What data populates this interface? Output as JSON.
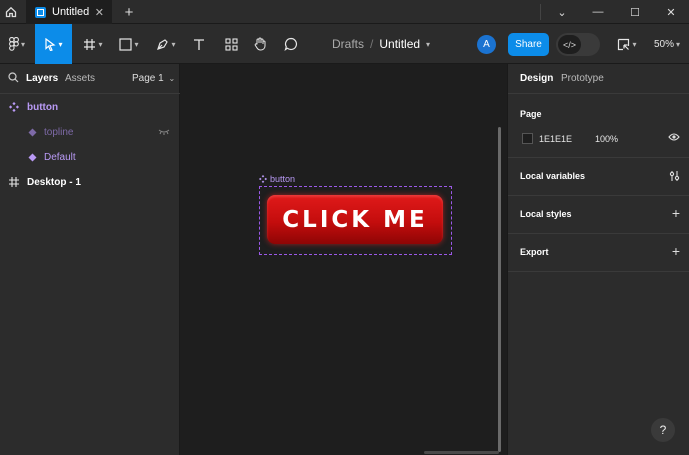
{
  "titlebar": {
    "tab_label": "Untitled",
    "new_tab_symbol": "+",
    "close_symbol": "✕",
    "win_chevron": "⌄",
    "win_minimize": "—",
    "win_maximize": "☐",
    "win_close": "✕"
  },
  "toolbar": {
    "crumb_drafts": "Drafts",
    "crumb_sep": "/",
    "crumb_file": "Untitled",
    "avatar_initial": "A",
    "share_label": "Share",
    "dev_mode_symbol": "</>",
    "zoom_value": "50%",
    "tools": [
      "figma-menu",
      "move",
      "frame",
      "shape",
      "pen",
      "text",
      "components",
      "hand",
      "comment"
    ]
  },
  "left_panel": {
    "tab_layers": "Layers",
    "tab_assets": "Assets",
    "page_selector": "Page 1",
    "layers": [
      {
        "name": "button",
        "kind": "component-set",
        "color": "#b99af5"
      },
      {
        "name": "topline",
        "kind": "variant-hidden",
        "color": "#7e6aa8"
      },
      {
        "name": "Default",
        "kind": "variant",
        "color": "#b99af5"
      },
      {
        "name": "Desktop - 1",
        "kind": "frame",
        "color": "#ffffff"
      }
    ]
  },
  "canvas": {
    "frame_label": "button",
    "button_text": "CLICK ME",
    "button_color": "#d41111"
  },
  "right_panel": {
    "tab_design": "Design",
    "tab_prototype": "Prototype",
    "page_section_title": "Page",
    "page_color_hex": "1E1E1E",
    "page_opacity": "100%",
    "local_variables": "Local variables",
    "local_styles": "Local styles",
    "export": "Export",
    "help_symbol": "?"
  },
  "colors": {
    "accent": "#0c8ce9",
    "component": "#b99af5",
    "panel": "#2c2c2c",
    "canvas": "#1e1e1e"
  }
}
